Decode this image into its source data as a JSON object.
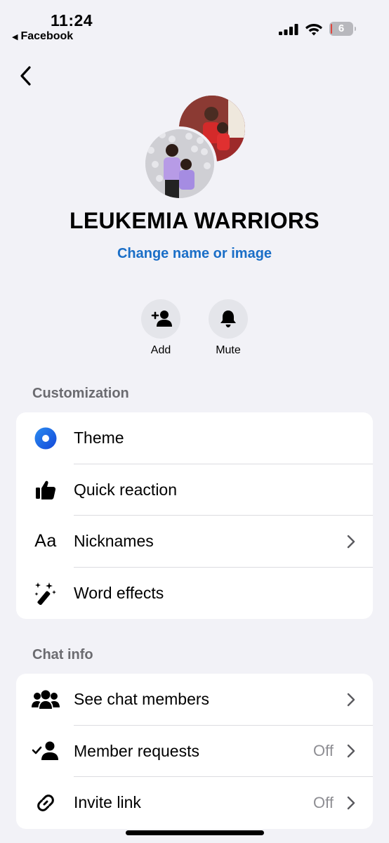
{
  "status_bar": {
    "time": "11:24",
    "back_app": "Facebook",
    "battery_level": "6"
  },
  "group": {
    "name": "LEUKEMIA WARRIORS",
    "change_link": "Change name or image"
  },
  "actions": [
    {
      "label": "Add",
      "icon": "add-person-icon"
    },
    {
      "label": "Mute",
      "icon": "bell-icon"
    }
  ],
  "customization": {
    "header": "Customization",
    "items": [
      {
        "label": "Theme",
        "icon": "theme-icon"
      },
      {
        "label": "Quick reaction",
        "icon": "thumbs-up-icon"
      },
      {
        "label": "Nicknames",
        "icon": "text-aa-icon"
      },
      {
        "label": "Word effects",
        "icon": "magic-wand-icon"
      }
    ]
  },
  "chat_info": {
    "header": "Chat info",
    "items": [
      {
        "label": "See chat members",
        "icon": "people-icon",
        "value": ""
      },
      {
        "label": "Member requests",
        "icon": "person-check-icon",
        "value": "Off"
      },
      {
        "label": "Invite link",
        "icon": "link-icon",
        "value": "Off"
      }
    ]
  },
  "colors": {
    "link": "#1a6ec7",
    "theme_blue": "#1565e8",
    "background": "#f2f2f7"
  }
}
